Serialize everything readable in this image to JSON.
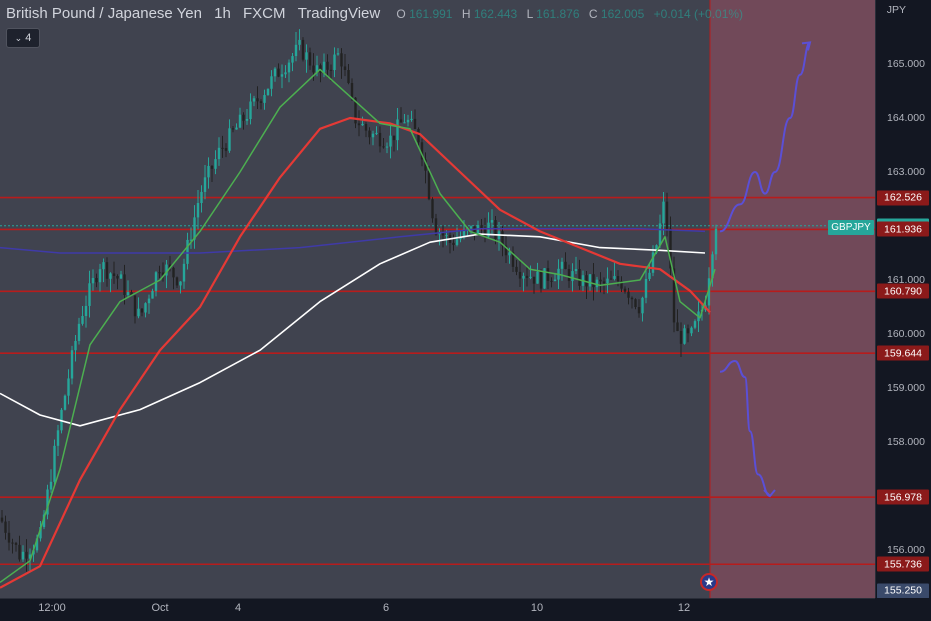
{
  "header": {
    "symbol_title": "British Pound / Japanese Yen",
    "interval": "1h",
    "broker": "FXCM",
    "platform": "TradingView",
    "ohlc": {
      "o_label": "O",
      "o": "161.991",
      "h_label": "H",
      "h": "162.443",
      "l_label": "L",
      "l": "161.876",
      "c_label": "C",
      "c": "162.005",
      "change": "+0.014 (+0.01%)"
    },
    "indicator_count": "4"
  },
  "axis": {
    "currency": "JPY",
    "price_ticks": [
      "165.000",
      "164.000",
      "163.000",
      "161.000",
      "160.000",
      "159.000",
      "158.000",
      "156.000"
    ],
    "time_ticks": [
      "12:00",
      "Oct",
      "4",
      "6",
      "10",
      "12"
    ]
  },
  "price_tags": [
    {
      "value": "162.526",
      "color": "#8b1a1a"
    },
    {
      "value": "162.005",
      "color": "#26a69a"
    },
    {
      "value": "161.936",
      "color": "#8b1a1a"
    },
    {
      "value": "160.790",
      "color": "#8b1a1a"
    },
    {
      "value": "159.644",
      "color": "#8b1a1a"
    },
    {
      "value": "156.978",
      "color": "#8b1a1a"
    },
    {
      "value": "155.736",
      "color": "#8b1a1a"
    },
    {
      "value": "155.250",
      "color": "#3a4a6a"
    }
  ],
  "symbol_tag": "GBPJPY",
  "colors": {
    "up": "#26a69a",
    "down": "#222222",
    "ema_fast": "#4caf50",
    "ema_mid": "#e53935",
    "sma_slow": "#ffffff",
    "ma_blue": "#3f3aa8",
    "level": "#b71c1c",
    "projection": "#5b4fd6",
    "zone": "#7a4a5a"
  },
  "chart_data": {
    "type": "candlestick",
    "title": "British Pound / Japanese Yen 1h FXCM TradingView",
    "ylabel": "JPY",
    "ylim": [
      155.1,
      166.1
    ],
    "x_ticks": [
      "12:00",
      "Oct",
      "4",
      "6",
      "10",
      "12"
    ],
    "horizontal_levels": [
      162.526,
      161.936,
      160.79,
      159.644,
      156.978,
      155.736
    ],
    "last_price": 162.005,
    "price_path": [
      [
        0,
        156.6
      ],
      [
        20,
        155.9
      ],
      [
        40,
        156.2
      ],
      [
        60,
        158.4
      ],
      [
        80,
        160.3
      ],
      [
        100,
        161.3
      ],
      [
        120,
        161.0
      ],
      [
        140,
        160.3
      ],
      [
        160,
        161.3
      ],
      [
        180,
        161.0
      ],
      [
        200,
        162.6
      ],
      [
        220,
        163.4
      ],
      [
        240,
        163.9
      ],
      [
        260,
        164.4
      ],
      [
        280,
        164.9
      ],
      [
        300,
        165.3
      ],
      [
        320,
        164.8
      ],
      [
        340,
        165.2
      ],
      [
        355,
        164.0
      ],
      [
        370,
        163.7
      ],
      [
        390,
        163.6
      ],
      [
        405,
        164.0
      ],
      [
        420,
        163.6
      ],
      [
        435,
        162.0
      ],
      [
        450,
        161.7
      ],
      [
        470,
        161.9
      ],
      [
        490,
        162.0
      ],
      [
        505,
        161.6
      ],
      [
        520,
        161.2
      ],
      [
        540,
        161.0
      ],
      [
        560,
        161.2
      ],
      [
        580,
        161.0
      ],
      [
        600,
        160.9
      ],
      [
        620,
        161.0
      ],
      [
        640,
        160.5
      ],
      [
        655,
        161.5
      ],
      [
        665,
        162.5
      ],
      [
        675,
        160.0
      ],
      [
        690,
        159.9
      ],
      [
        705,
        160.6
      ],
      [
        715,
        162.0
      ],
      [
        720,
        162.4
      ]
    ],
    "ema_fast": [
      [
        0,
        155.4
      ],
      [
        30,
        155.8
      ],
      [
        60,
        157.5
      ],
      [
        90,
        159.8
      ],
      [
        120,
        160.6
      ],
      [
        160,
        161.0
      ],
      [
        200,
        161.9
      ],
      [
        240,
        163.0
      ],
      [
        280,
        164.2
      ],
      [
        320,
        164.9
      ],
      [
        350,
        164.4
      ],
      [
        380,
        163.9
      ],
      [
        410,
        163.8
      ],
      [
        440,
        162.6
      ],
      [
        470,
        161.9
      ],
      [
        500,
        161.7
      ],
      [
        530,
        161.2
      ],
      [
        560,
        161.1
      ],
      [
        600,
        160.9
      ],
      [
        640,
        161.0
      ],
      [
        665,
        161.8
      ],
      [
        680,
        160.6
      ],
      [
        700,
        160.3
      ],
      [
        715,
        161.2
      ]
    ],
    "ema_mid": [
      [
        0,
        155.3
      ],
      [
        40,
        155.7
      ],
      [
        80,
        157.3
      ],
      [
        120,
        158.6
      ],
      [
        160,
        159.7
      ],
      [
        200,
        160.5
      ],
      [
        240,
        161.8
      ],
      [
        280,
        162.9
      ],
      [
        320,
        163.8
      ],
      [
        350,
        164.0
      ],
      [
        390,
        163.9
      ],
      [
        420,
        163.7
      ],
      [
        460,
        163.0
      ],
      [
        500,
        162.3
      ],
      [
        540,
        161.9
      ],
      [
        580,
        161.6
      ],
      [
        620,
        161.3
      ],
      [
        660,
        161.2
      ],
      [
        690,
        160.8
      ],
      [
        710,
        160.4
      ]
    ],
    "sma_slow": [
      [
        0,
        158.9
      ],
      [
        40,
        158.5
      ],
      [
        80,
        158.3
      ],
      [
        140,
        158.6
      ],
      [
        200,
        159.1
      ],
      [
        260,
        159.7
      ],
      [
        320,
        160.6
      ],
      [
        380,
        161.3
      ],
      [
        430,
        161.7
      ],
      [
        480,
        161.85
      ],
      [
        540,
        161.8
      ],
      [
        600,
        161.6
      ],
      [
        660,
        161.55
      ],
      [
        705,
        161.5
      ]
    ],
    "ma_blue": [
      [
        0,
        161.6
      ],
      [
        60,
        161.5
      ],
      [
        120,
        161.5
      ],
      [
        200,
        161.5
      ],
      [
        300,
        161.6
      ],
      [
        400,
        161.8
      ],
      [
        480,
        161.95
      ],
      [
        560,
        161.95
      ],
      [
        640,
        161.95
      ],
      [
        705,
        161.9
      ]
    ],
    "projection_up": [
      [
        720,
        161.9
      ],
      [
        740,
        162.4
      ],
      [
        755,
        163.0
      ],
      [
        765,
        162.6
      ],
      [
        775,
        163.0
      ],
      [
        790,
        164.0
      ],
      [
        800,
        164.8
      ],
      [
        810,
        165.4
      ]
    ],
    "projection_down": [
      [
        720,
        159.3
      ],
      [
        735,
        159.5
      ],
      [
        745,
        159.2
      ],
      [
        750,
        158.2
      ],
      [
        758,
        157.4
      ],
      [
        770,
        157.0
      ]
    ]
  }
}
